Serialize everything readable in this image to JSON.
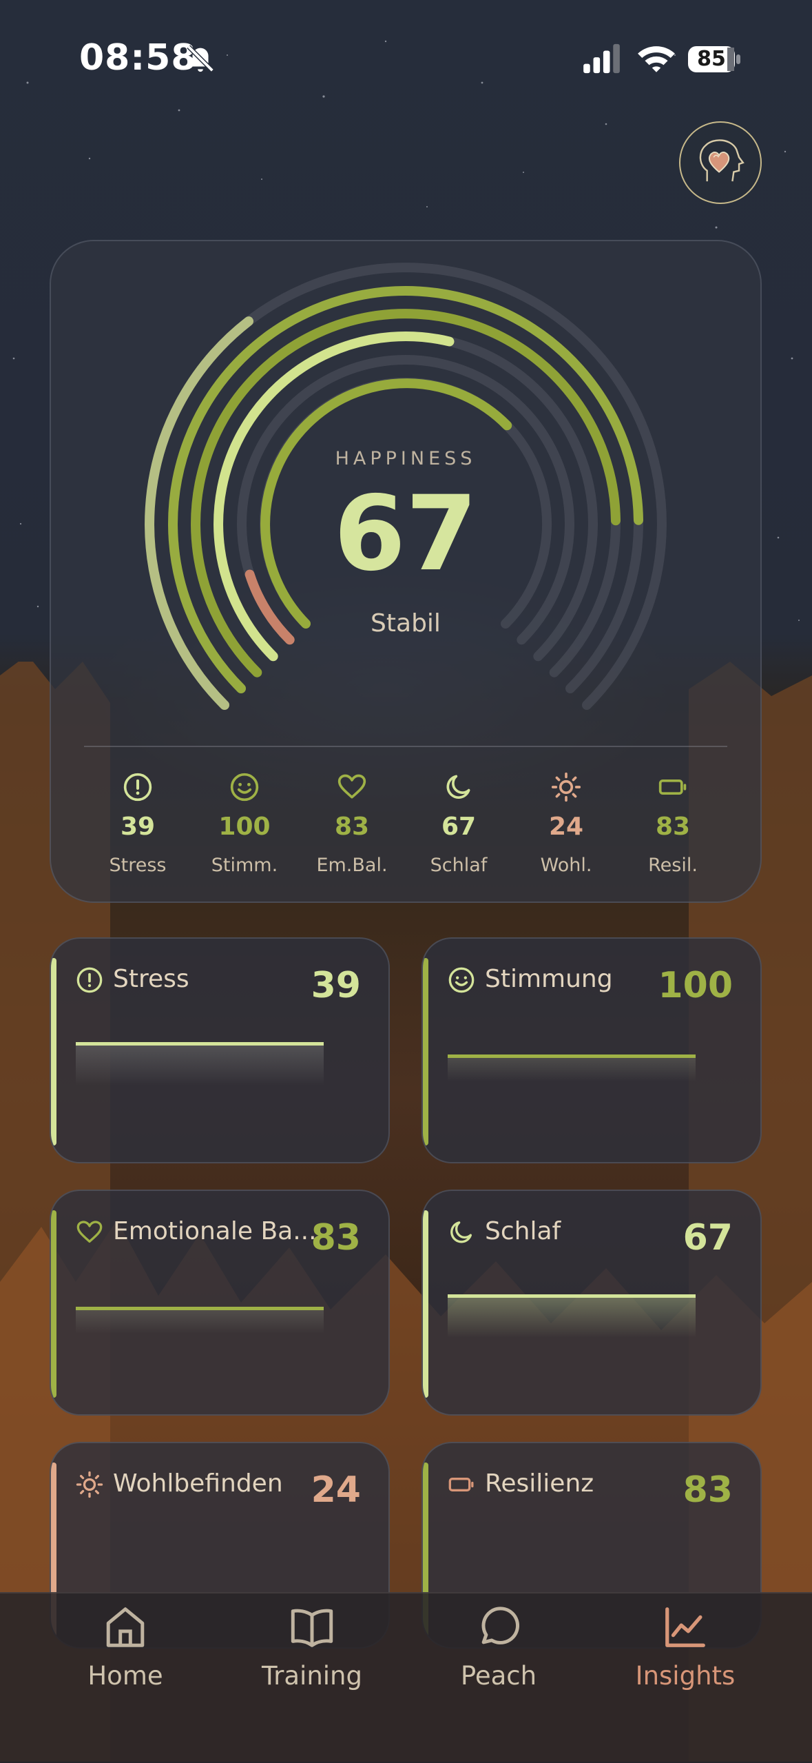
{
  "status_bar": {
    "time": "08:58",
    "battery": "85"
  },
  "header": {
    "avatar_icon": "head-heart-icon"
  },
  "happiness": {
    "label": "HAPPINESS",
    "value": "67",
    "state": "Stabil",
    "rings": [
      {
        "metric": "Resilienz",
        "fraction": 0.36,
        "color": "#b5bf84"
      },
      {
        "metric": "Wohlbefinden",
        "fraction": 0.83,
        "color": "#98ac40"
      },
      {
        "metric": "Schlaf",
        "fraction": 0.83,
        "color": "#8fa236"
      },
      {
        "metric": "Emotionale Balance",
        "fraction": 0.55,
        "color": "#d2e38e"
      },
      {
        "metric": "Stimmung",
        "fraction": 0.1,
        "color": "#c8826a"
      },
      {
        "metric": "Stress",
        "fraction": 0.67,
        "color": "#97ab3c"
      }
    ]
  },
  "metrics": [
    {
      "icon": "alert-circle-icon",
      "value": "39",
      "label": "Stress",
      "color": "#d4e49a"
    },
    {
      "icon": "smiley-icon",
      "value": "100",
      "label": "Stimm.",
      "color": "#9fb246"
    },
    {
      "icon": "heart-icon",
      "value": "83",
      "label": "Em.Bal.",
      "color": "#9fb246"
    },
    {
      "icon": "moon-icon",
      "value": "67",
      "label": "Schlaf",
      "color": "#d4e49a"
    },
    {
      "icon": "sun-icon",
      "value": "24",
      "label": "Wohl.",
      "color": "#e0a98b"
    },
    {
      "icon": "battery-icon",
      "value": "83",
      "label": "Resil.",
      "color": "#9fb246"
    }
  ],
  "tiles": [
    {
      "icon": "alert-circle-icon",
      "title": "Stress",
      "value": "39",
      "color": "#d4e49a"
    },
    {
      "icon": "smiley-icon",
      "title": "Stimmung",
      "value": "100",
      "color": "#9fb246"
    },
    {
      "icon": "heart-icon",
      "title": "Emotionale Ba...",
      "value": "83",
      "color": "#9fb246"
    },
    {
      "icon": "moon-icon",
      "title": "Schlaf",
      "value": "67",
      "color": "#d4e49a"
    },
    {
      "icon": "sun-icon",
      "title": "Wohlbefinden",
      "value": "24",
      "color": "#e0a98b"
    },
    {
      "icon": "battery-icon",
      "title": "Resilienz",
      "value": "83",
      "color": "#9fb246"
    }
  ],
  "tabs": [
    {
      "icon": "home-icon",
      "label": "Home",
      "active": false
    },
    {
      "icon": "book-icon",
      "label": "Training",
      "active": false
    },
    {
      "icon": "chat-bubble-icon",
      "label": "Peach",
      "active": false
    },
    {
      "icon": "chart-icon",
      "label": "Insights",
      "active": true
    }
  ],
  "colors": {
    "accent_green": "#9fb246",
    "accent_light": "#d4e49a",
    "accent_peach": "#e0a98b",
    "active_tab": "#d89678",
    "inactive_tab": "#cfc3ad"
  }
}
